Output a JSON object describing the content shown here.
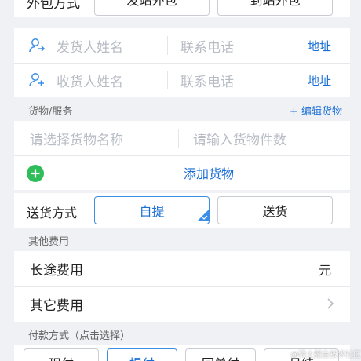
{
  "top_row": {
    "label": "外包方式",
    "option1": "发站外包",
    "option2": "到站外包"
  },
  "sender": {
    "name_placeholder": "发货人姓名",
    "phone_placeholder": "联系电话",
    "address_link": "地址"
  },
  "receiver": {
    "name_placeholder": "收货人姓名",
    "phone_placeholder": "联系电话",
    "address_link": "地址"
  },
  "goods": {
    "section_title": "货物/服务",
    "edit_link": "+ 编辑货物",
    "name_placeholder": "请选择货物名称",
    "count_placeholder": "请输入货物件数",
    "add_label": "添加货物"
  },
  "delivery": {
    "label": "送货方式",
    "options": [
      "自提",
      "送货"
    ],
    "selected": "自提"
  },
  "other_fees": {
    "section_title": "其他费用",
    "long_distance_label": "长途费用",
    "long_distance_unit": "元",
    "other_label": "其它费用"
  },
  "payment": {
    "section_title": "付款方式（点击选择）",
    "options": [
      "现付",
      "提付",
      "回单付",
      "月结"
    ]
  },
  "watermark": "@稀土掘金技术社区",
  "colors": {
    "accent": "#1a6fd6",
    "add_green": "#2fbd5a",
    "background": "#f0f1f5"
  }
}
